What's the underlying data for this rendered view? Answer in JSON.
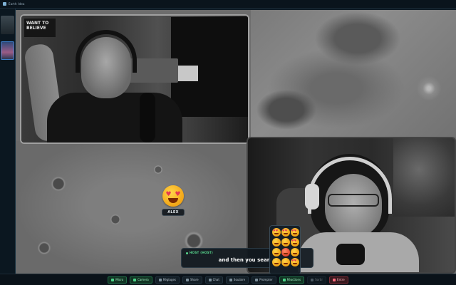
{
  "app": {
    "title": "Earth Idea"
  },
  "participants": {
    "alex": {
      "name": "ALEX",
      "sign_text": "WANT TO BELIEVE"
    },
    "host": {
      "speaker_label": "HOST (HOST)"
    }
  },
  "caption": {
    "text": "and then you search"
  },
  "emoji_picker": {
    "emojis": [
      "heart-eyes",
      "heart-eyes",
      "heart-eyes",
      "smile",
      "smile",
      "heart-eyes",
      "smile",
      "angry",
      "smile",
      "smile",
      "smile",
      "heart-eyes"
    ]
  },
  "toolbar": {
    "mic_label": "Micro",
    "camera_label": "Camera",
    "settings_label": "Réglages",
    "share_label": "Share",
    "chat_label": "Chat",
    "soundsets_label": "Soulaire",
    "prompter_label": "Prompter",
    "reactions_label": "Réactions",
    "exit_label": "Sortir",
    "exit2_label": "Entre"
  },
  "colors": {
    "accent_green": "#4bd488",
    "accent_red": "#ff6a7d",
    "background": "#0d1a24"
  }
}
